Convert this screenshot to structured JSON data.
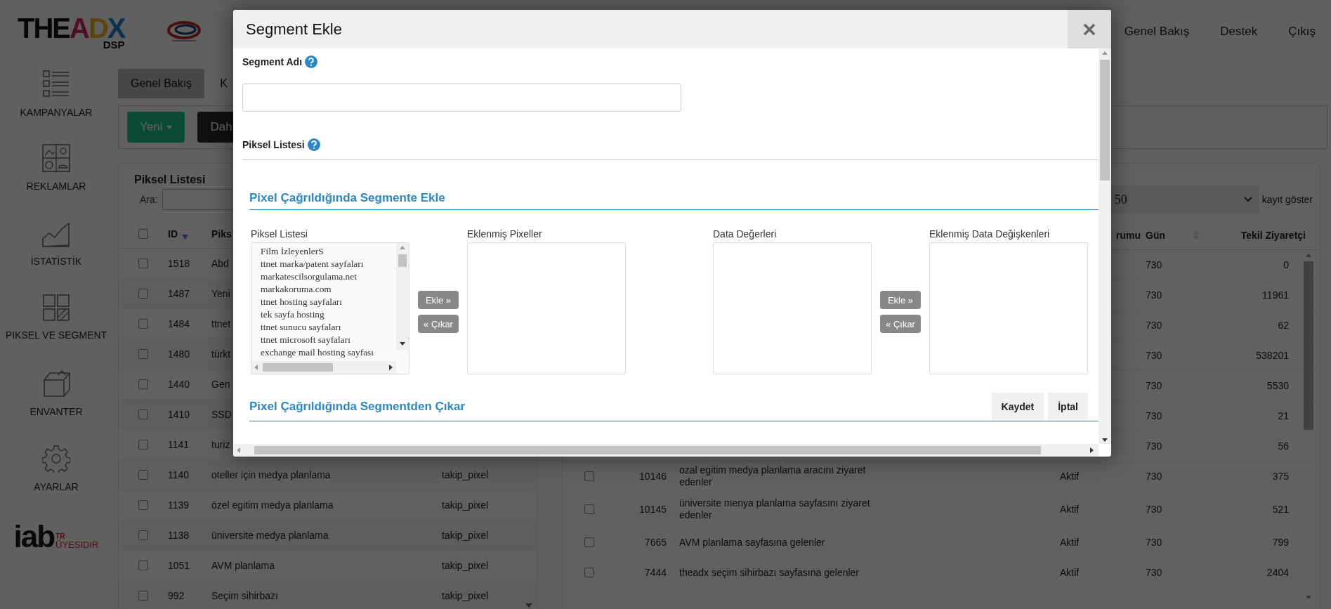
{
  "logo": {
    "text": "THEADX",
    "sub": "DSP"
  },
  "top_nav": [
    "Genel Bakış",
    "Destek",
    "Çıkış"
  ],
  "sidebar": {
    "items": [
      {
        "label": "KAMPANYALAR",
        "kind": "list"
      },
      {
        "label": "REKLAMLAR",
        "kind": "images"
      },
      {
        "label": "İSTATİSTİK",
        "kind": "chart"
      },
      {
        "label": "PIKSEL VE SEGMENT",
        "kind": "grid"
      },
      {
        "label": "ENVANTER",
        "kind": "box"
      },
      {
        "label": "AYARLAR",
        "kind": "gear"
      }
    ],
    "badge": {
      "brand": "iab",
      "country": "TR",
      "text": "ÜYESIDIR"
    }
  },
  "tabs": [
    {
      "label": "Genel Bakış",
      "selected": true
    },
    {
      "label": "K",
      "selected": false
    }
  ],
  "toolbar": {
    "buttons": [
      {
        "label": "Yeni",
        "kind": "primary",
        "dropdown": true
      },
      {
        "label": "Dah",
        "kind": "dark",
        "dropdown": false
      }
    ]
  },
  "pixel_list": {
    "title": "Piksel Listesi",
    "search_label": "Ara:",
    "all_checked": false,
    "columns": [
      "ID",
      "Piks"
    ],
    "rows": [
      {
        "checked": false,
        "id": "1518",
        "name": "Abd"
      },
      {
        "checked": false,
        "id": "1487",
        "name": "Yeni"
      },
      {
        "checked": false,
        "id": "1484",
        "name": "ttnet"
      },
      {
        "checked": false,
        "id": "1480",
        "name": "türkt"
      },
      {
        "checked": false,
        "id": "1440",
        "name": "Gen"
      },
      {
        "checked": false,
        "id": "1410",
        "name": "SSD"
      },
      {
        "checked": false,
        "id": "1141",
        "name": "turiz"
      },
      {
        "checked": false,
        "id": "1140",
        "name": "oteller için medya planlama",
        "type": "takip_pixel"
      },
      {
        "checked": false,
        "id": "1139",
        "name": "özel egitim medya planlama",
        "type": "takip_pixel"
      },
      {
        "checked": false,
        "id": "1138",
        "name": "üniversite medya planlama",
        "type": "takip_pixel"
      },
      {
        "checked": false,
        "id": "1051",
        "name": "AVM planlama",
        "type": "takip_pixel"
      },
      {
        "checked": false,
        "id": "992",
        "name": "Seçim sihirbazı",
        "type": "takip_pixel"
      }
    ]
  },
  "segment_list": {
    "page_size": "50",
    "page_size_label": "kayıt göster",
    "columns": [
      "rumu",
      "Gün",
      "Tekil Ziyaretçi"
    ],
    "rows": [
      {
        "days": "730",
        "visitors": "0"
      },
      {
        "days": "730",
        "visitors": "11961"
      },
      {
        "days": "730",
        "visitors": "62"
      },
      {
        "days": "730",
        "visitors": "538201"
      },
      {
        "days": "730",
        "visitors": "5530"
      },
      {
        "days": "730",
        "visitors": "21"
      },
      {
        "days": "730",
        "visitors": "56"
      },
      {
        "checked": false,
        "id": "10146",
        "name": "ozal egitim medya planlama aracını ziyaret edenler",
        "status": "Aktif",
        "days": "730",
        "visitors": "375"
      },
      {
        "checked": false,
        "id": "10145",
        "name": "üniversite menya planlama sayfasını ziyaret edenler",
        "status": "Aktif",
        "days": "730",
        "visitors": "521"
      },
      {
        "checked": false,
        "id": "7665",
        "name": "AVM planlama sayfasına gelenler",
        "status": "Aktif",
        "days": "730",
        "visitors": "799"
      },
      {
        "checked": false,
        "id": "7444",
        "name": "theadx seçim sihirbazı sayfasına gelenler",
        "status": "Aktif",
        "days": "730",
        "visitors": "2404"
      }
    ]
  },
  "modal": {
    "title": "Segment Ekle",
    "name_label": "Segment Adı",
    "pixel_label": "Piksel Listesi",
    "add_section": {
      "title": "Pixel Çağrıldığında Segmente Ekle",
      "transfers": [
        {
          "source": {
            "label": "Piksel Listesi",
            "items": [
              "Film İzleyenlerS",
              "ttnet marka/patent sayfaları",
              "markatescilsorgulama.net",
              "markakoruma.com",
              "ttnet hosting sayfaları",
              "tek sayfa hosting",
              "ttnet sunucu sayfaları",
              "ttnet microsoft sayfaları",
              "exchange mail hosting sayfası"
            ]
          },
          "add": "Ekle »",
          "remove": "« Çıkar",
          "target": {
            "label": "Eklenmiş Pixeller"
          }
        },
        {
          "source": {
            "label": "Data Değerleri"
          },
          "add": "Ekle »",
          "remove": "« Çıkar",
          "target": {
            "label": "Eklenmiş Data Değişkenleri"
          }
        }
      ]
    },
    "remove_section": {
      "title": "Pixel Çağrıldığında Segmentden Çıkar"
    },
    "actions": [
      "Kaydet",
      "İptal"
    ]
  }
}
